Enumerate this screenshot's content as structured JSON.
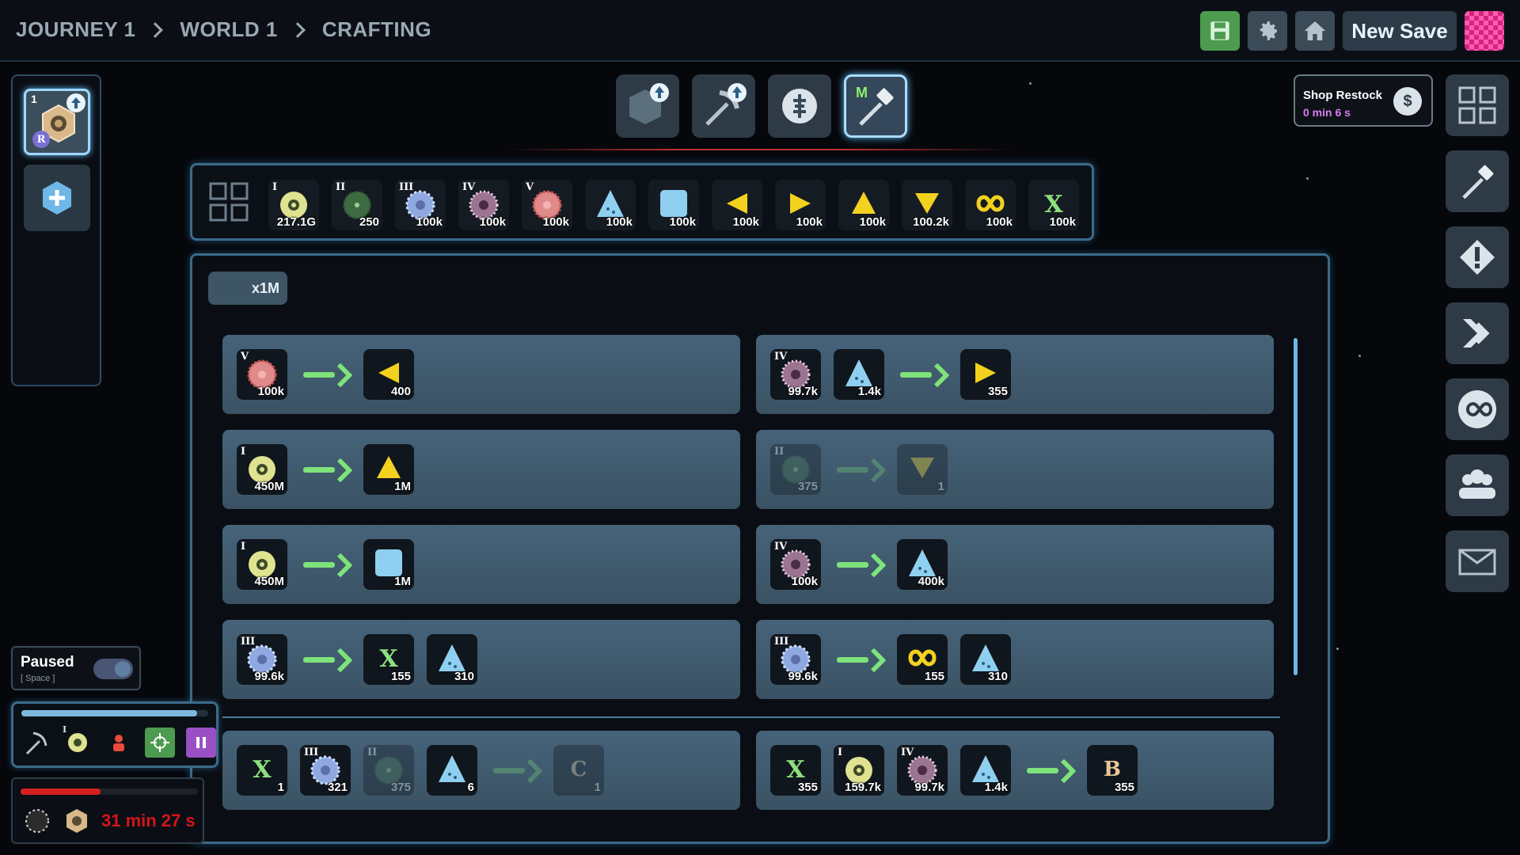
{
  "breadcrumb": [
    "JOURNEY 1",
    "WORLD 1",
    "CRAFTING"
  ],
  "topbar": {
    "new_save_label": "New Save"
  },
  "slot": {
    "number": "1",
    "badge": "R"
  },
  "shop": {
    "title": "Shop Restock",
    "time": "0 min 6 s"
  },
  "tools": [
    {
      "name": "upgrade-hexagon"
    },
    {
      "name": "upgrade-pickaxe"
    },
    {
      "name": "currency"
    },
    {
      "name": "hammer",
      "letter": "M"
    }
  ],
  "inventory": [
    {
      "tier": "I",
      "count": "217.1G",
      "icon": "ore-yellow"
    },
    {
      "tier": "II",
      "count": "250",
      "icon": "ore-green"
    },
    {
      "tier": "III",
      "count": "100k",
      "icon": "ore-blue"
    },
    {
      "tier": "IV",
      "count": "100k",
      "icon": "ore-purple"
    },
    {
      "tier": "V",
      "count": "100k",
      "icon": "ore-red"
    },
    {
      "tier": "",
      "count": "100k",
      "icon": "triangle-blue"
    },
    {
      "tier": "",
      "count": "100k",
      "icon": "square-blue"
    },
    {
      "tier": "",
      "count": "100k",
      "icon": "arrow-left-yellow"
    },
    {
      "tier": "",
      "count": "100k",
      "icon": "arrow-right-yellow"
    },
    {
      "tier": "",
      "count": "100k",
      "icon": "triangle-up-yellow"
    },
    {
      "tier": "",
      "count": "100.2k",
      "icon": "triangle-down-yellow"
    },
    {
      "tier": "",
      "count": "100k",
      "icon": "infinity-yellow"
    },
    {
      "tier": "",
      "count": "100k",
      "icon": "x-green"
    }
  ],
  "multiplier": "x1M",
  "recipes": [
    {
      "inputs": [
        {
          "tier": "V",
          "count": "100k",
          "icon": "ore-red"
        }
      ],
      "outputs": [
        {
          "count": "400",
          "icon": "arrow-left-yellow"
        }
      ],
      "dim": false
    },
    {
      "inputs": [
        {
          "tier": "IV",
          "count": "99.7k",
          "icon": "ore-purple"
        },
        {
          "count": "1.4k",
          "icon": "triangle-blue"
        }
      ],
      "outputs": [
        {
          "count": "355",
          "icon": "arrow-right-yellow"
        }
      ],
      "dim": false
    },
    {
      "inputs": [
        {
          "tier": "I",
          "count": "450M",
          "icon": "ore-yellow"
        }
      ],
      "outputs": [
        {
          "count": "1M",
          "icon": "triangle-up-yellow"
        }
      ],
      "dim": false
    },
    {
      "inputs": [
        {
          "tier": "II",
          "count": "375",
          "icon": "ore-green"
        }
      ],
      "outputs": [
        {
          "count": "1",
          "icon": "triangle-down-yellow"
        }
      ],
      "dim": true
    },
    {
      "inputs": [
        {
          "tier": "I",
          "count": "450M",
          "icon": "ore-yellow"
        }
      ],
      "outputs": [
        {
          "count": "1M",
          "icon": "square-blue"
        }
      ],
      "dim": false
    },
    {
      "inputs": [
        {
          "tier": "IV",
          "count": "100k",
          "icon": "ore-purple"
        }
      ],
      "outputs": [
        {
          "count": "400k",
          "icon": "triangle-blue"
        }
      ],
      "dim": false
    },
    {
      "inputs": [
        {
          "tier": "III",
          "count": "99.6k",
          "icon": "ore-blue"
        }
      ],
      "outputs": [
        {
          "count": "155",
          "icon": "x-green"
        },
        {
          "count": "310",
          "icon": "triangle-blue"
        }
      ],
      "dim": false
    },
    {
      "inputs": [
        {
          "tier": "III",
          "count": "99.6k",
          "icon": "ore-blue"
        }
      ],
      "outputs": [
        {
          "count": "155",
          "icon": "infinity-yellow"
        },
        {
          "count": "310",
          "icon": "triangle-blue"
        }
      ],
      "dim": false
    },
    {
      "inputs": [
        {
          "count": "1",
          "icon": "x-green"
        },
        {
          "tier": "III",
          "count": "321",
          "icon": "ore-blue"
        },
        {
          "tier": "II",
          "count": "375",
          "icon": "ore-green",
          "dim": true
        },
        {
          "count": "6",
          "icon": "triangle-blue"
        }
      ],
      "outputs": [
        {
          "count": "1",
          "icon": "letter-c",
          "letter": "C",
          "dim": true
        }
      ],
      "dim": false,
      "arrow_dim": true
    },
    {
      "inputs": [
        {
          "count": "355",
          "icon": "x-green"
        },
        {
          "tier": "I",
          "count": "159.7k",
          "icon": "ore-yellow"
        },
        {
          "tier": "IV",
          "count": "99.7k",
          "icon": "ore-purple"
        },
        {
          "count": "1.4k",
          "icon": "triangle-blue"
        }
      ],
      "outputs": [
        {
          "count": "355",
          "icon": "letter-b",
          "letter": "B"
        }
      ],
      "dim": false
    }
  ],
  "paused": {
    "label": "Paused",
    "key": "[ Space ]",
    "on": true
  },
  "miner": {
    "progress": 0.94
  },
  "timer": {
    "text": "31 min 27 s",
    "progress": 0.45
  },
  "colors": {
    "accent": "#6fb7e6",
    "arrow": "#7ee37a",
    "timer_red": "#d3151a",
    "save_green": "#4d9b4f"
  }
}
